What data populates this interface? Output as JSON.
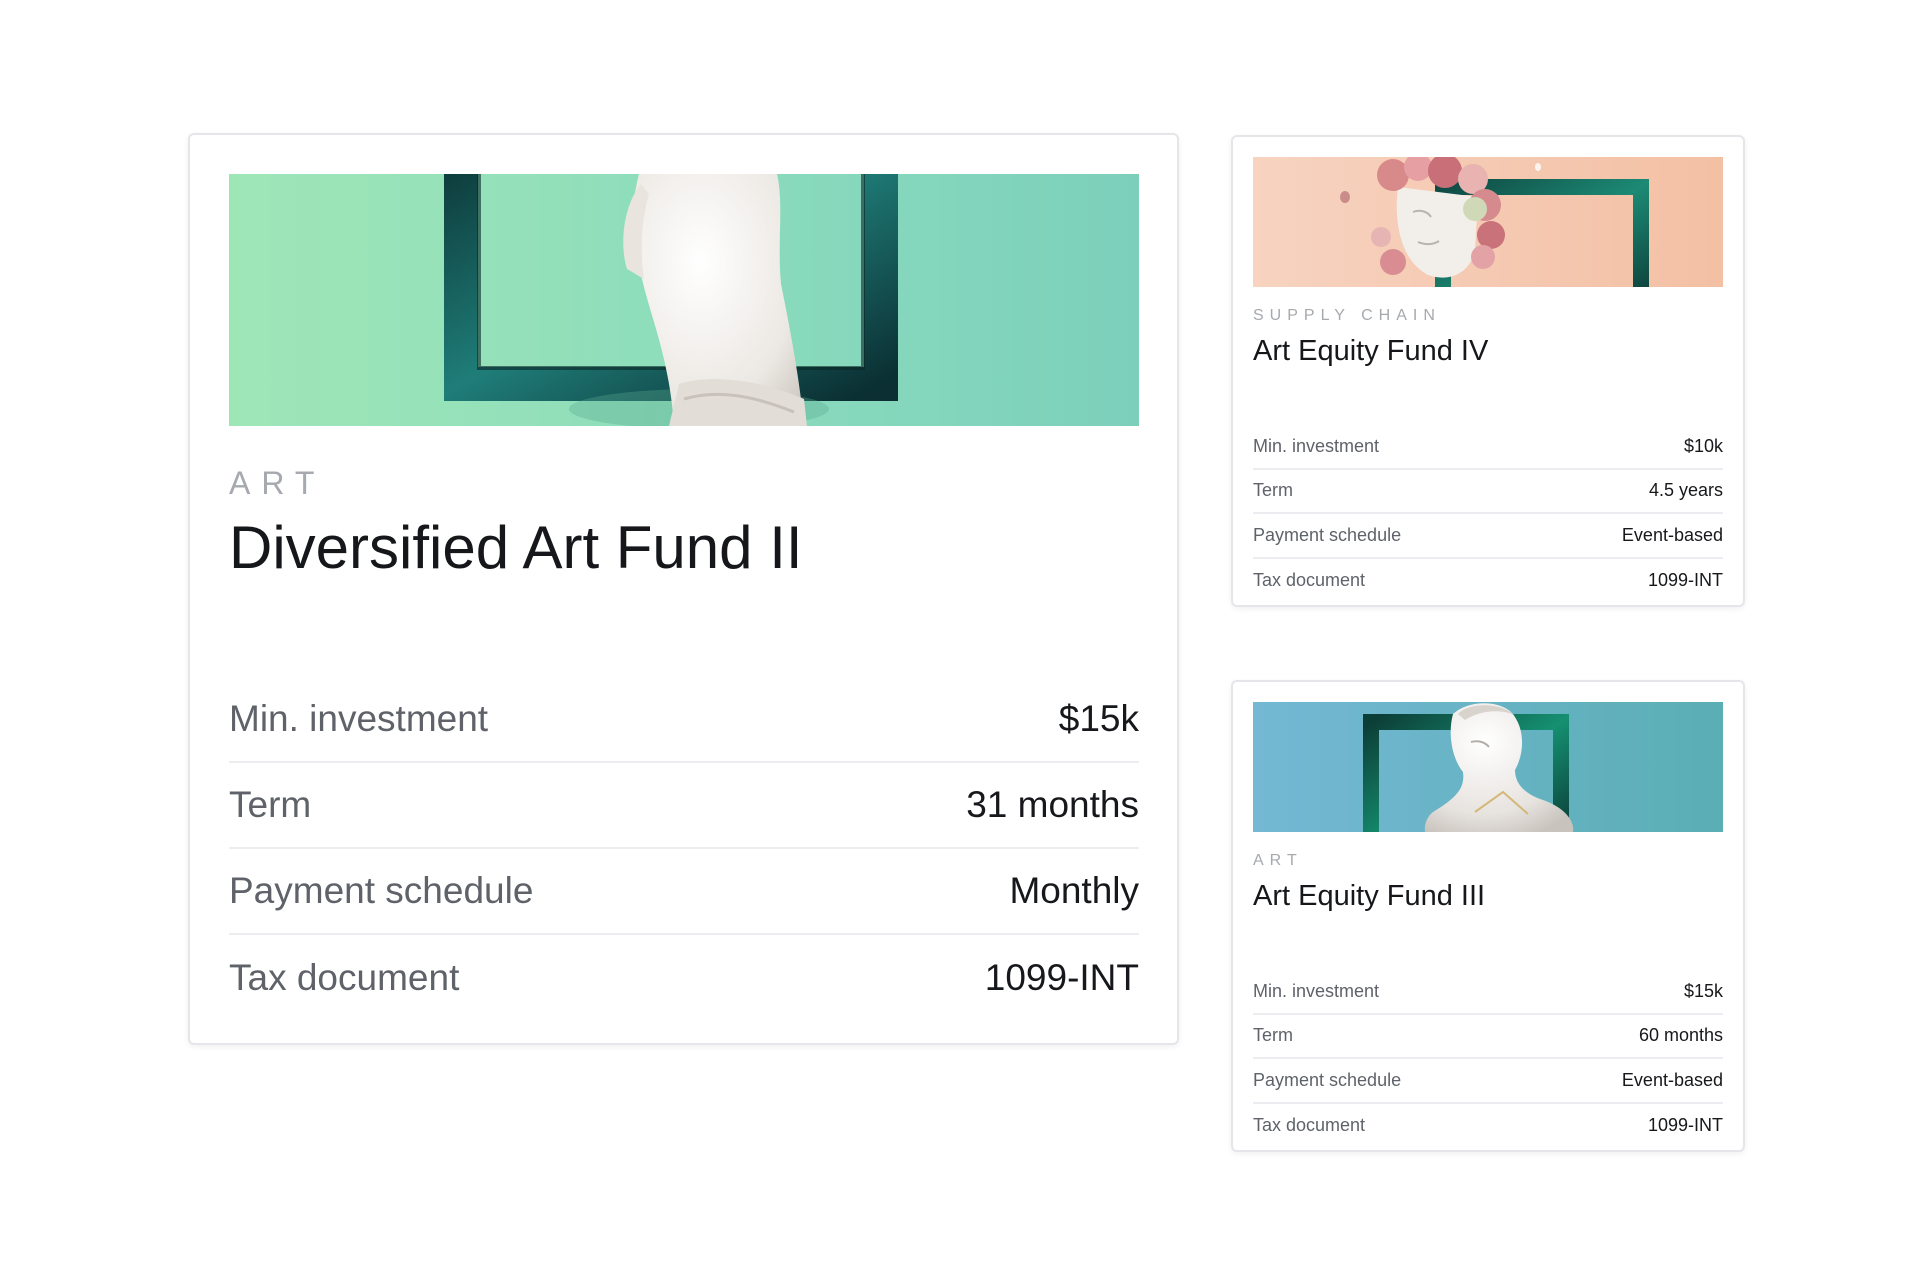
{
  "cards": {
    "main": {
      "category": "ART",
      "title": "Diversified Art Fund II",
      "rows": [
        {
          "label": "Min. investment",
          "value": "$15k"
        },
        {
          "label": "Term",
          "value": "31 months"
        },
        {
          "label": "Payment schedule",
          "value": "Monthly"
        },
        {
          "label": "Tax document",
          "value": "1099-INT"
        }
      ]
    },
    "fund4": {
      "category": "SUPPLY CHAIN",
      "title": "Art Equity Fund IV",
      "rows": [
        {
          "label": "Min. investment",
          "value": "$10k"
        },
        {
          "label": "Term",
          "value": "4.5 years"
        },
        {
          "label": "Payment schedule",
          "value": "Event-based"
        },
        {
          "label": "Tax document",
          "value": "1099-INT"
        }
      ]
    },
    "fund3": {
      "category": "ART",
      "title": "Art Equity Fund III",
      "rows": [
        {
          "label": "Min. investment",
          "value": "$15k"
        },
        {
          "label": "Term",
          "value": "60 months"
        },
        {
          "label": "Payment schedule",
          "value": "Event-based"
        },
        {
          "label": "Tax document",
          "value": "1099-INT"
        }
      ]
    }
  },
  "images": {
    "main": {
      "subject": "torso-statue-in-frame-image",
      "background": "#95e2b8"
    },
    "fund4": {
      "subject": "flower-bust-in-frame-image",
      "background": "#f6c9b3"
    },
    "fund3": {
      "subject": "bust-statue-in-frame-image",
      "background": "#6fb6d0"
    }
  }
}
